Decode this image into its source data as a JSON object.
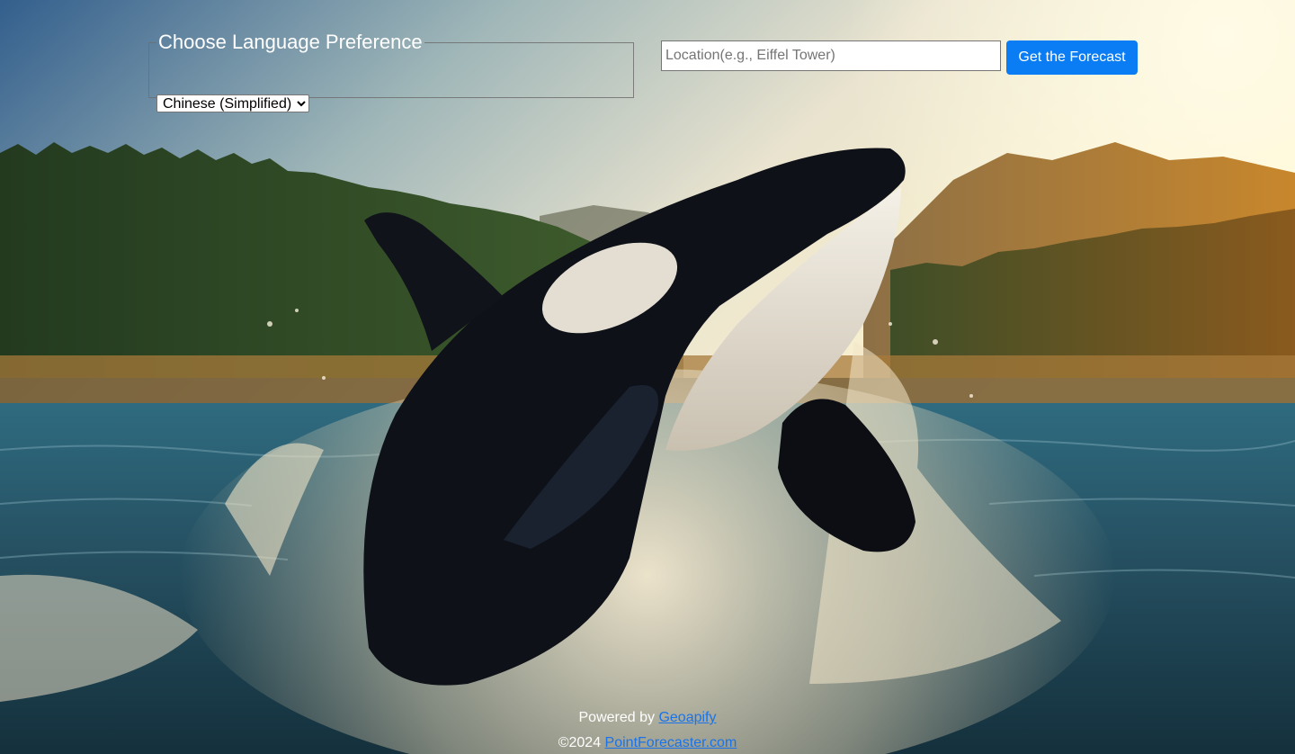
{
  "language": {
    "legend": "Choose Language Preference",
    "selected": "Chinese (Simplified)"
  },
  "search": {
    "placeholder": "Location(e.g., Eiffel Tower)",
    "value": "",
    "button_label": "Get the Forecast",
    "button_color": "#0a7cf4"
  },
  "footer": {
    "powered_prefix": "Powered by",
    "powered_link": "Geoapify",
    "copyright_prefix": "©2024",
    "site_link": "PointForecaster.com",
    "link_color": "#1a73e8"
  },
  "background": {
    "subject": "orca breaching water",
    "colors": {
      "sky_left": "#3e6f9a",
      "sky_right": "#fff4cf",
      "forest": "#2f4a24",
      "mountain": "#a3763a",
      "water": "#2a5a6c",
      "spray": "#f3e6c6",
      "orca_black": "#0d0f15",
      "orca_white": "#f1ece2"
    }
  }
}
